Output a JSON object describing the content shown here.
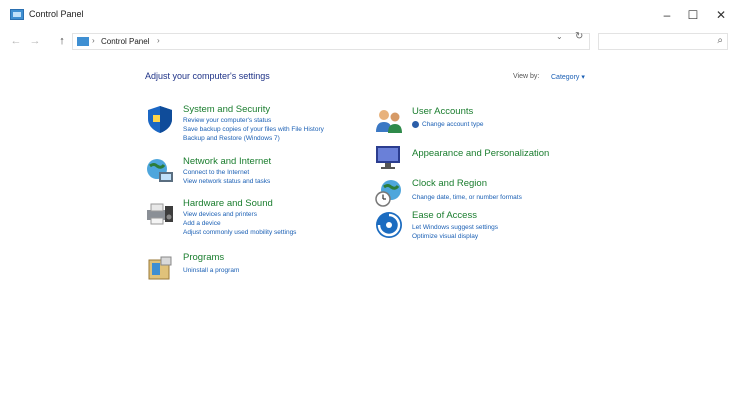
{
  "window": {
    "title": "Control Panel"
  },
  "titlebar_buttons": {
    "minimize": "–",
    "maximize": "☐",
    "close": "✕"
  },
  "nav": {
    "back": "←",
    "forward": "→",
    "up": "↑"
  },
  "address": {
    "crumb": "Control Panel",
    "sep1": "›",
    "sep2": "›",
    "dropdown": "⌄",
    "refresh": "↻"
  },
  "search": {
    "placeholder": "",
    "icon": "search-icon"
  },
  "main": {
    "heading": "Adjust your computer's settings",
    "view_by_label": "View by:",
    "view_by_value": "Category ▾"
  },
  "categories": [
    {
      "title": "System and Security",
      "icon": "shield-icon",
      "links": [
        "Review your computer's status",
        "Save backup copies of your files with File History",
        "Backup and Restore (Windows 7)"
      ]
    },
    {
      "title": "Network and Internet",
      "icon": "network-globe-icon",
      "links": [
        "Connect to the Internet",
        "View network status and tasks"
      ]
    },
    {
      "title": "Hardware and Sound",
      "icon": "printer-speaker-icon",
      "links": [
        "View devices and printers",
        "Add a device",
        "Adjust commonly used mobility settings"
      ]
    },
    {
      "title": "Programs",
      "icon": "programs-box-icon",
      "links": [
        "Uninstall a program"
      ]
    },
    {
      "title": "User Accounts",
      "icon": "users-icon",
      "links": [
        "Change account type"
      ]
    },
    {
      "title": "Appearance and Personalization",
      "icon": "monitor-palette-icon",
      "links": []
    },
    {
      "title": "Clock and Region",
      "icon": "clock-globe-icon",
      "links": [
        "Change date, time, or number formats"
      ]
    },
    {
      "title": "Ease of Access",
      "icon": "ease-of-access-icon",
      "links": [
        "Let Windows suggest settings",
        "Optimize visual display"
      ]
    }
  ],
  "colors": {
    "category_title": "#1a7d2e",
    "link": "#1a5fb4",
    "heading": "#1e3287"
  }
}
